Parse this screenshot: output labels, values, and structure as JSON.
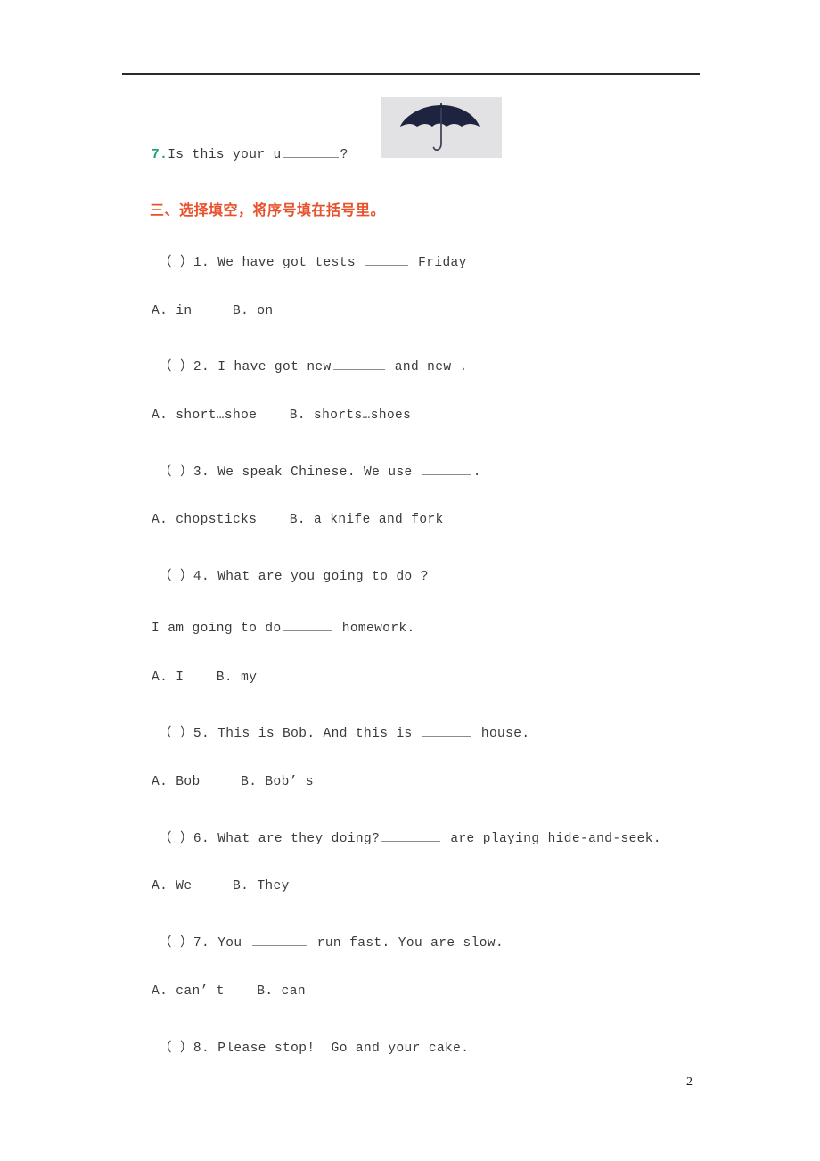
{
  "document": {
    "page_number": "2",
    "accent_colors": {
      "section_heading": "#e8512c",
      "item_number_green": "#19a06a",
      "body_text": "#3a3a3a",
      "rule": "#2a2a2a",
      "umbrella_canopy": "#1e2340",
      "umbrella_background": "#e2e2e4"
    }
  },
  "carryover_item": {
    "number": "7.",
    "text_before_blank": "Is this your u",
    "text_after_blank": "?",
    "picture_alt": "umbrella-picture"
  },
  "section": {
    "heading": "三、选择填空，将序号填在括号里。"
  },
  "questions": [
    {
      "marker": "（ ）1.",
      "stem_before": " We have got tests ",
      "stem_after": " Friday",
      "options": "A. in     B. on"
    },
    {
      "marker": "（ ）2.",
      "stem_before": " I have got new",
      "stem_after": " and new .",
      "options": "A. short…shoe    B. shorts…shoes"
    },
    {
      "marker": "（ ）3.",
      "stem_before": " We speak Chinese. We use ",
      "stem_after": ".",
      "options": "A. chopsticks    B. a knife and fork"
    },
    {
      "marker": "（ ）4.",
      "stem_before": " What are you going to do ?",
      "stem_after": "",
      "second_line_before": "I am going to do",
      "second_line_after": " homework.",
      "options": "A. I    B. my"
    },
    {
      "marker": "（ ）5.",
      "stem_before": " This is Bob. And this is ",
      "stem_after": " house.",
      "options": "A. Bob     B. Bob’ s"
    },
    {
      "marker": "（ ）6.",
      "stem_before": " What are they doing?",
      "stem_after": " are playing hide-and-seek.",
      "options": "A. We     B. They"
    },
    {
      "marker": "（ ）7.",
      "stem_before": " You ",
      "stem_after": " run fast. You are slow.",
      "options": "A. can’ t    B. can"
    },
    {
      "marker": "（ ）8.",
      "stem_before": " Please stop!  Go and your cake.",
      "stem_after": "",
      "options": ""
    }
  ]
}
